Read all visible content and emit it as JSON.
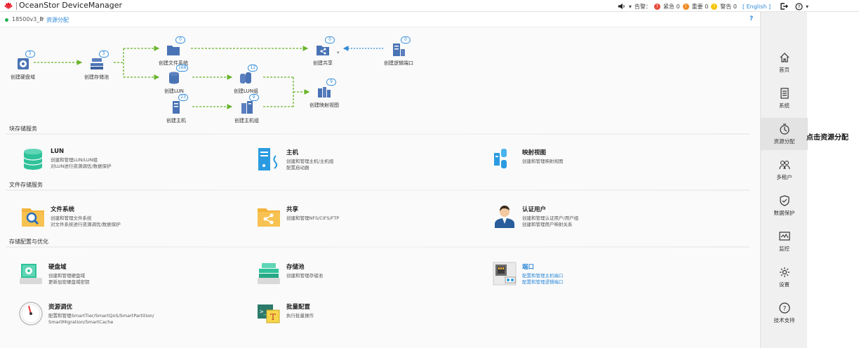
{
  "topbar": {
    "brand": "OceanStor DeviceManager",
    "alarm_label": "告警：",
    "critical_label": "紧急",
    "critical_count": "0",
    "major_label": "重要",
    "major_count": "0",
    "warning_label": "警告",
    "warning_count": "0",
    "language": "[ English ]",
    "colors": {
      "critical": "#e84b3c",
      "major": "#f08a24",
      "warning": "#f5c400"
    }
  },
  "breadcrumb": {
    "device": "18500v3_B",
    "separator": ">",
    "current": "资源分配",
    "help": "?"
  },
  "flow": {
    "nodes": {
      "disk_domain": {
        "label": "创建硬盘域",
        "count": "3"
      },
      "storage_pool": {
        "label": "创建存储池",
        "count": "3"
      },
      "file_system": {
        "label": "创建文件系统",
        "count": "0"
      },
      "share": {
        "label": "创建共享",
        "count": "0"
      },
      "logical_port": {
        "label": "创建逻辑端口",
        "count": "0"
      },
      "lun": {
        "label": "创建LUN",
        "count": "168"
      },
      "lun_group": {
        "label": "创建LUN组",
        "count": "12"
      },
      "mapping_view": {
        "label": "创建映射视图",
        "count": "9"
      },
      "host": {
        "label": "创建主机",
        "count": "23"
      },
      "host_group": {
        "label": "创建主机组",
        "count": "9"
      }
    }
  },
  "sections": {
    "block": {
      "title": "块存储服务",
      "tiles": {
        "lun": {
          "title": "LUN",
          "lines": [
            "创建和管理LUN/LUN组",
            "对LUN进行资源调优/数据保护"
          ]
        },
        "host": {
          "title": "主机",
          "lines": [
            "创建和管理主机/主机组",
            "配置启动器"
          ]
        },
        "mapping": {
          "title": "映射视图",
          "lines": [
            "创建和管理映射视图"
          ]
        }
      }
    },
    "file": {
      "title": "文件存储服务",
      "tiles": {
        "fs": {
          "title": "文件系统",
          "lines": [
            "创建和管理文件系统",
            "对文件系统进行资源调优/数据保护"
          ]
        },
        "share": {
          "title": "共享",
          "lines": [
            "创建和管理NFS/CIFS/FTP"
          ]
        },
        "auth": {
          "title": "认证用户",
          "lines": [
            "创建和管理认证用户/用户组",
            "创建和管理用户映射关系"
          ]
        }
      }
    },
    "config": {
      "title": "存储配置与优化",
      "tiles": {
        "disk_domain": {
          "title": "硬盘域",
          "lines": [
            "创建和管理硬盘域",
            "更新加密硬盘域密钥"
          ]
        },
        "pool": {
          "title": "存储池",
          "lines": [
            "创建和管理存储池"
          ]
        },
        "port": {
          "title": "端口",
          "lines": [
            "配置和管理主机端口",
            "配置和管理逻辑端口"
          ]
        },
        "tuning": {
          "title": "资源调优",
          "lines": [
            "配置和管理SmartTier/SmartQoS/SmartPartition/",
            "SmartMigration/SmartCache"
          ]
        },
        "batch": {
          "title": "批量配置",
          "lines": [
            "执行批量操作"
          ]
        }
      }
    }
  },
  "sidebar": {
    "items": [
      {
        "label": "首页",
        "icon": "home-icon"
      },
      {
        "label": "系统",
        "icon": "system-icon"
      },
      {
        "label": "资源分配",
        "icon": "resource-allocation-icon",
        "active": true
      },
      {
        "label": "多租户",
        "icon": "multi-tenant-icon"
      },
      {
        "label": "数据保护",
        "icon": "data-protection-icon"
      },
      {
        "label": "监控",
        "icon": "monitor-icon"
      },
      {
        "label": "设置",
        "icon": "settings-icon"
      },
      {
        "label": "技术支持",
        "icon": "tech-support-icon"
      }
    ]
  },
  "callout": "点击资源分配"
}
